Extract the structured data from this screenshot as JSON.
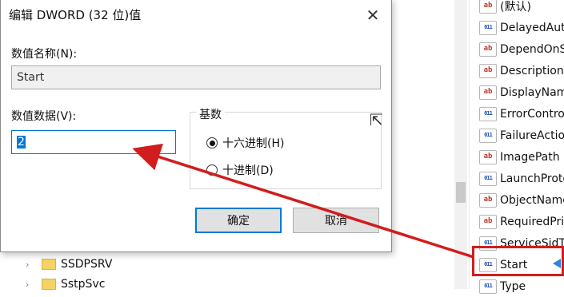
{
  "dialog": {
    "title": "编辑 DWORD (32 位)值",
    "close_glyph": "✕",
    "value_name_label": "数值名称(N):",
    "value_name": "Start",
    "value_data_label": "数值数据(V):",
    "value_data": "2",
    "base_label": "基数",
    "radio_hex": "十六进制(H)",
    "radio_dec": "十进制(D)",
    "selected_base": "hex",
    "ok_label": "确定",
    "cancel_label": "取消"
  },
  "registry_values": [
    {
      "type": "sz",
      "name": "(默认)"
    },
    {
      "type": "bin",
      "name": "DelayedAutoStart"
    },
    {
      "type": "sz",
      "name": "DependOnService"
    },
    {
      "type": "sz",
      "name": "Description"
    },
    {
      "type": "sz",
      "name": "DisplayName"
    },
    {
      "type": "bin",
      "name": "ErrorControl"
    },
    {
      "type": "bin",
      "name": "FailureActions"
    },
    {
      "type": "sz",
      "name": "ImagePath"
    },
    {
      "type": "bin",
      "name": "LaunchProtected"
    },
    {
      "type": "sz",
      "name": "ObjectName"
    },
    {
      "type": "sz",
      "name": "RequiredPrivileges"
    },
    {
      "type": "bin",
      "name": "ServiceSidType"
    },
    {
      "type": "bin",
      "name": "Start"
    },
    {
      "type": "bin",
      "name": "Type"
    }
  ],
  "icon_glyphs": {
    "sz": "ab",
    "bin": "011"
  },
  "tree": [
    {
      "name": "SSDPSRV"
    },
    {
      "name": "SstpSvc"
    }
  ],
  "colors": {
    "highlight_box": "#d11d1d",
    "arrow": "#d11d1d",
    "accent": "#0078d7"
  }
}
